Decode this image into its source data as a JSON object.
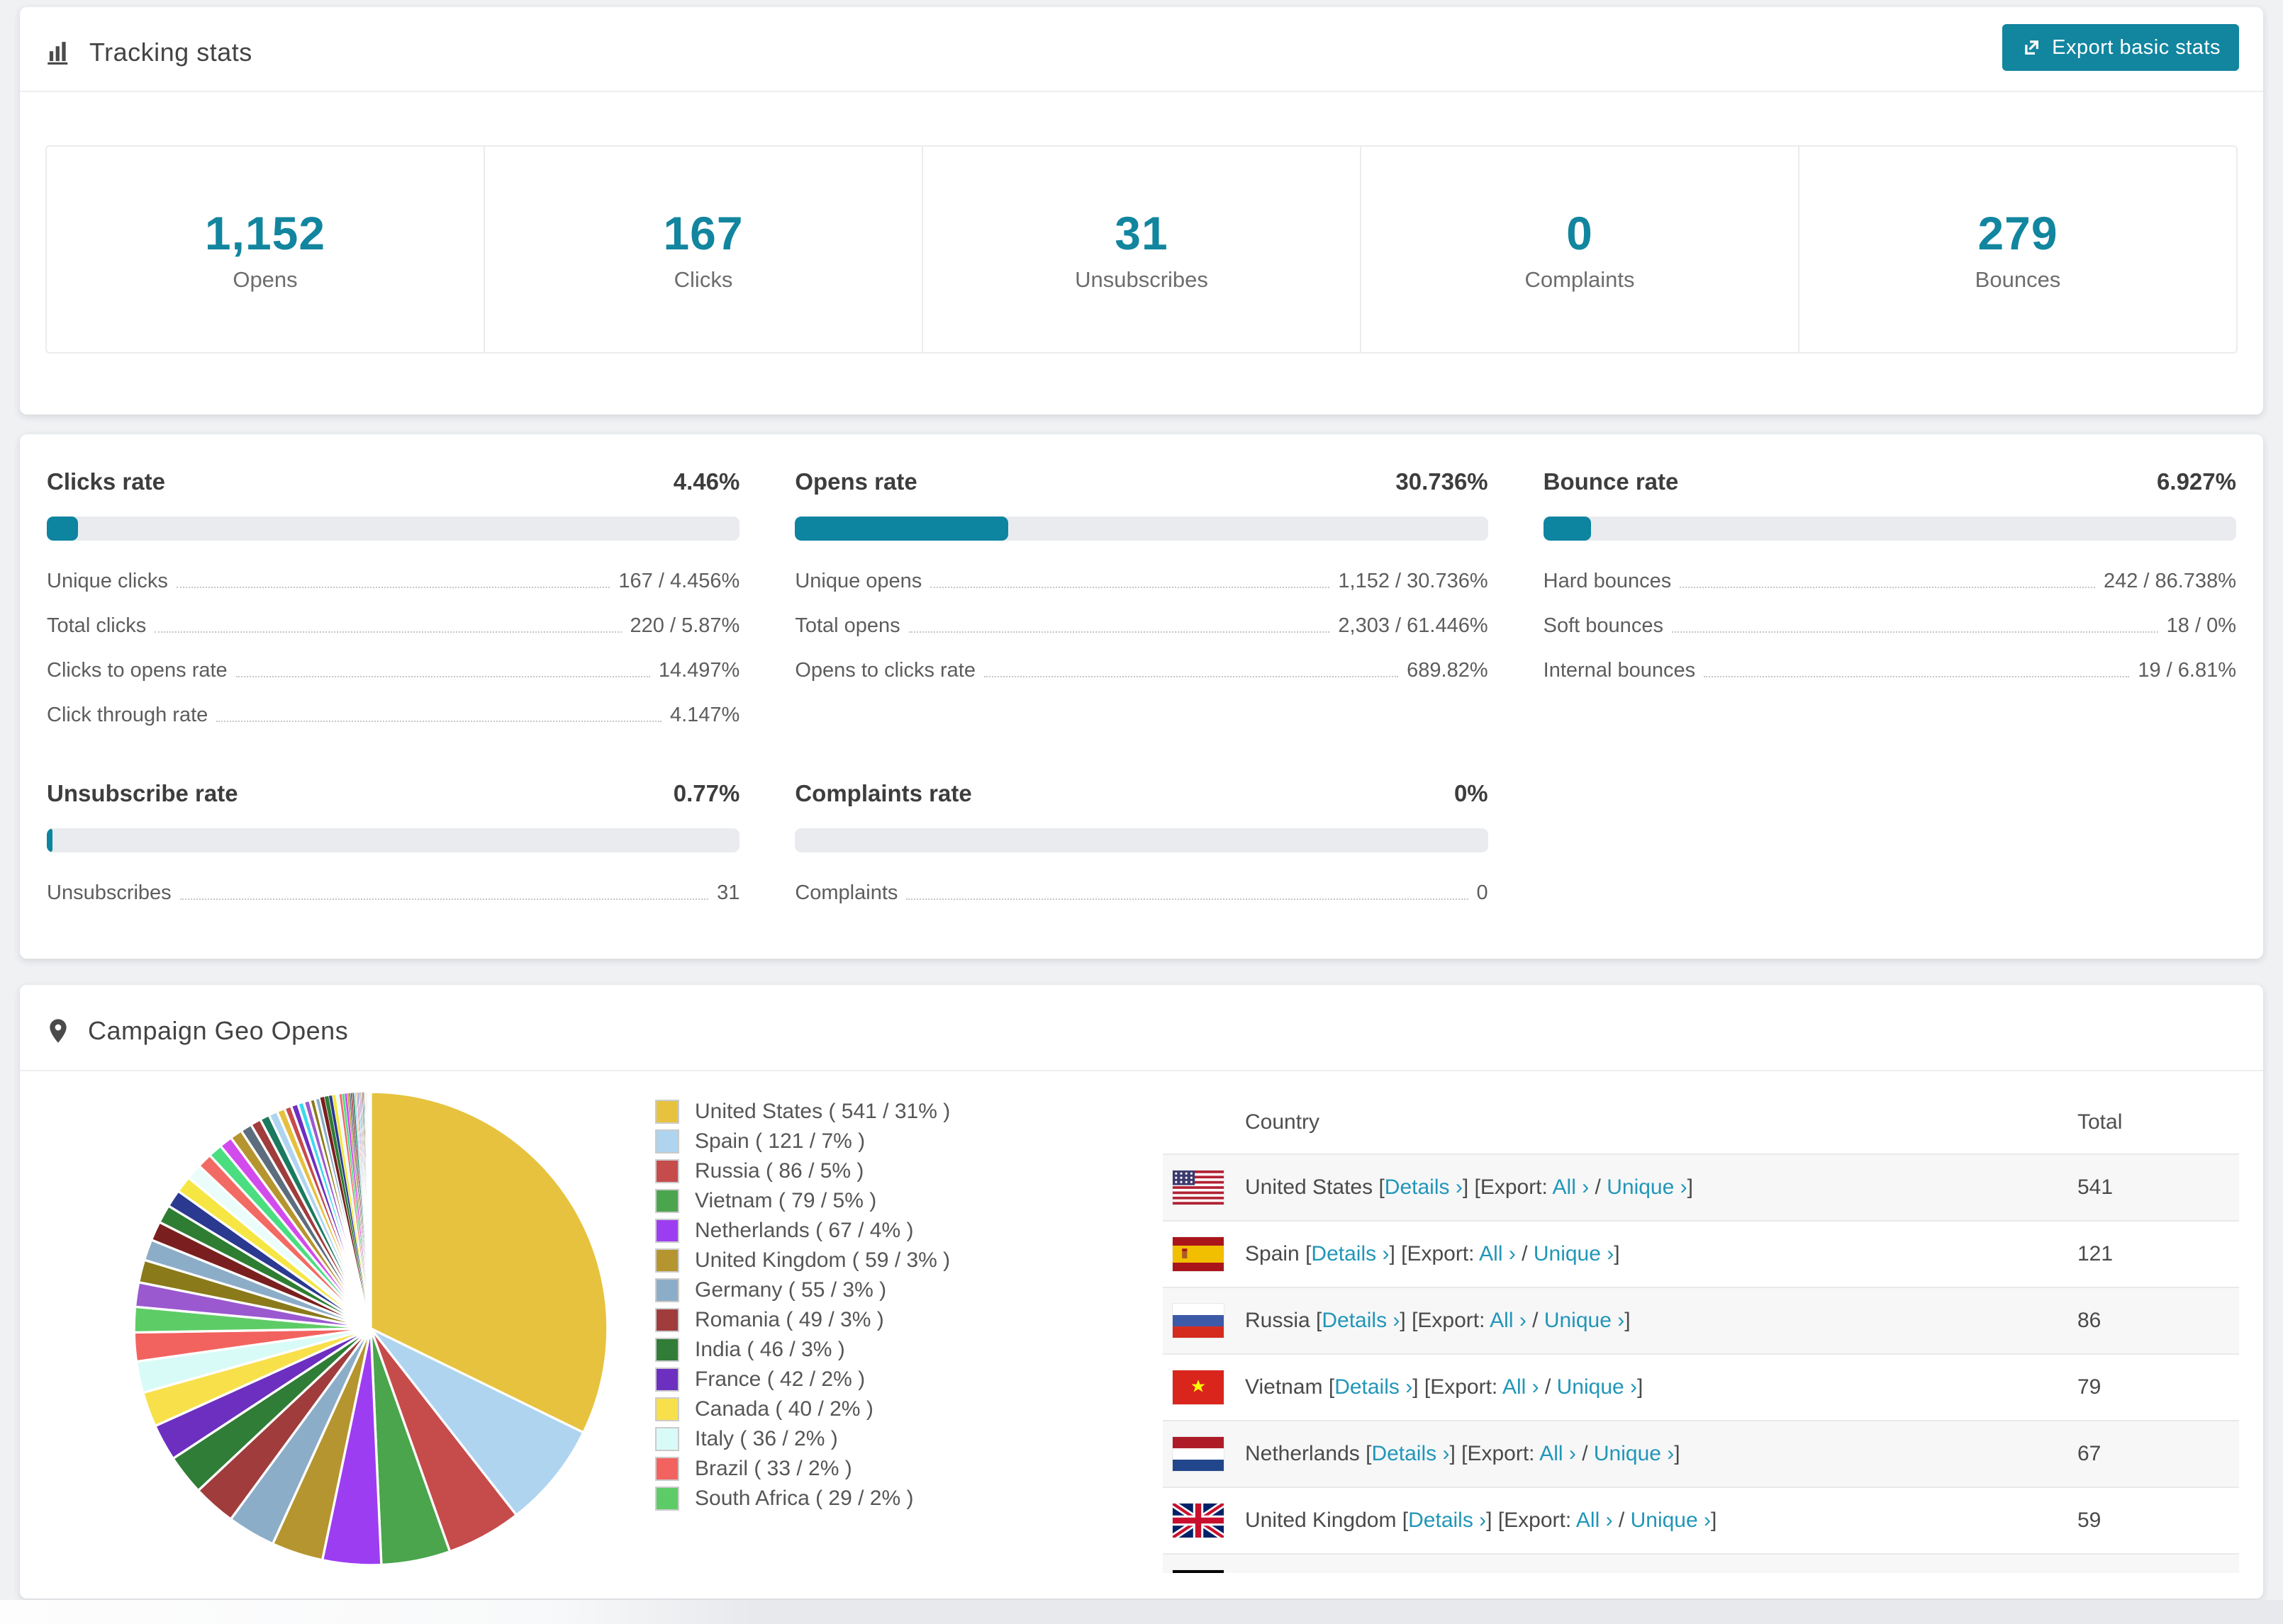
{
  "header": {
    "title": "Tracking stats",
    "export_label": "Export basic stats"
  },
  "stats": [
    {
      "value": "1,152",
      "label": "Opens"
    },
    {
      "value": "167",
      "label": "Clicks"
    },
    {
      "value": "31",
      "label": "Unsubscribes"
    },
    {
      "value": "0",
      "label": "Complaints"
    },
    {
      "value": "279",
      "label": "Bounces"
    }
  ],
  "rates": {
    "clicks": {
      "title": "Clicks rate",
      "value": "4.46%",
      "percent": 4.46,
      "rows": [
        {
          "label": "Unique clicks",
          "value": "167 / 4.456%"
        },
        {
          "label": "Total clicks",
          "value": "220 / 5.87%"
        },
        {
          "label": "Clicks to opens rate",
          "value": "14.497%"
        },
        {
          "label": "Click through rate",
          "value": "4.147%"
        }
      ]
    },
    "opens": {
      "title": "Opens rate",
      "value": "30.736%",
      "percent": 30.736,
      "rows": [
        {
          "label": "Unique opens",
          "value": "1,152 / 30.736%"
        },
        {
          "label": "Total opens",
          "value": "2,303 / 61.446%"
        },
        {
          "label": "Opens to clicks rate",
          "value": "689.82%"
        }
      ]
    },
    "bounce": {
      "title": "Bounce rate",
      "value": "6.927%",
      "percent": 6.927,
      "rows": [
        {
          "label": "Hard bounces",
          "value": "242 / 86.738%"
        },
        {
          "label": "Soft bounces",
          "value": "18 / 0%"
        },
        {
          "label": "Internal bounces",
          "value": "19 / 6.81%"
        }
      ]
    },
    "unsubscribe": {
      "title": "Unsubscribe rate",
      "value": "0.77%",
      "percent": 0.77,
      "rows": [
        {
          "label": "Unsubscribes",
          "value": "31"
        }
      ]
    },
    "complaints": {
      "title": "Complaints rate",
      "value": "0%",
      "percent": 0,
      "rows": [
        {
          "label": "Complaints",
          "value": "0"
        }
      ]
    }
  },
  "geo": {
    "title": "Campaign Geo Opens",
    "table": {
      "country_header": "Country",
      "total_header": "Total",
      "details_label": "Details ›",
      "export_label": "Export:",
      "all_label": "All ›",
      "unique_label": "Unique ›",
      "visible_rows": 7
    }
  },
  "chart_data": {
    "type": "pie",
    "title": "Campaign Geo Opens",
    "unit": "opens",
    "series": [
      {
        "name": "United States",
        "value": 541,
        "pct": "31%",
        "color": "#e7c23e",
        "flag": "us"
      },
      {
        "name": "Spain",
        "value": 121,
        "pct": "7%",
        "color": "#aed4f0",
        "flag": "es"
      },
      {
        "name": "Russia",
        "value": 86,
        "pct": "5%",
        "color": "#c64b4b",
        "flag": "ru"
      },
      {
        "name": "Vietnam",
        "value": 79,
        "pct": "5%",
        "color": "#4aa54d",
        "flag": "vn"
      },
      {
        "name": "Netherlands",
        "value": 67,
        "pct": "4%",
        "color": "#9d3df2",
        "flag": "nl"
      },
      {
        "name": "United Kingdom",
        "value": 59,
        "pct": "3%",
        "color": "#b5952f",
        "flag": "gb"
      },
      {
        "name": "Germany",
        "value": 55,
        "pct": "3%",
        "color": "#8cadc8",
        "flag": "de"
      },
      {
        "name": "Romania",
        "value": 49,
        "pct": "3%",
        "color": "#a03c3c"
      },
      {
        "name": "India",
        "value": 46,
        "pct": "3%",
        "color": "#2f7d36"
      },
      {
        "name": "France",
        "value": 42,
        "pct": "2%",
        "color": "#6d2fbf"
      },
      {
        "name": "Canada",
        "value": 40,
        "pct": "2%",
        "color": "#f8e04b"
      },
      {
        "name": "Italy",
        "value": 36,
        "pct": "2%",
        "color": "#d9fbf7"
      },
      {
        "name": "Brazil",
        "value": 33,
        "pct": "2%",
        "color": "#f2635f"
      },
      {
        "name": "South Africa",
        "value": 29,
        "pct": "2%",
        "color": "#5ecc66"
      }
    ],
    "others_values": [
      28,
      26,
      24,
      22,
      21,
      20,
      19,
      18,
      17,
      16,
      15,
      14,
      13,
      12,
      11,
      10,
      9,
      8,
      8,
      7,
      7,
      6,
      6,
      5,
      5,
      4,
      4,
      4,
      3,
      3,
      3,
      2,
      2,
      2,
      2,
      2,
      1,
      1,
      1,
      1,
      1,
      1,
      1,
      1,
      1,
      0.8,
      0.8,
      0.7,
      0.7,
      0.6,
      0.6,
      0.5,
      0.5,
      0.4,
      0.4,
      0.3,
      0.3,
      0.25,
      0.2,
      0.2,
      0.15,
      0.15,
      0.1,
      0.1,
      0.1
    ],
    "others_palette": [
      "#9b59d0",
      "#8a7a1a",
      "#8cadc8",
      "#7a1f1f",
      "#2e7d32",
      "#2b3990",
      "#f5e643",
      "#eafdfb",
      "#f26a64",
      "#4ade80",
      "#d24bec",
      "#b5952f",
      "#5d6d7e",
      "#a03c3c",
      "#1a7a5e",
      "#aed4f0",
      "#e5c03f",
      "#c64b4b",
      "#6d2fbf",
      "#3dd9eb"
    ],
    "legend_position": "right"
  }
}
